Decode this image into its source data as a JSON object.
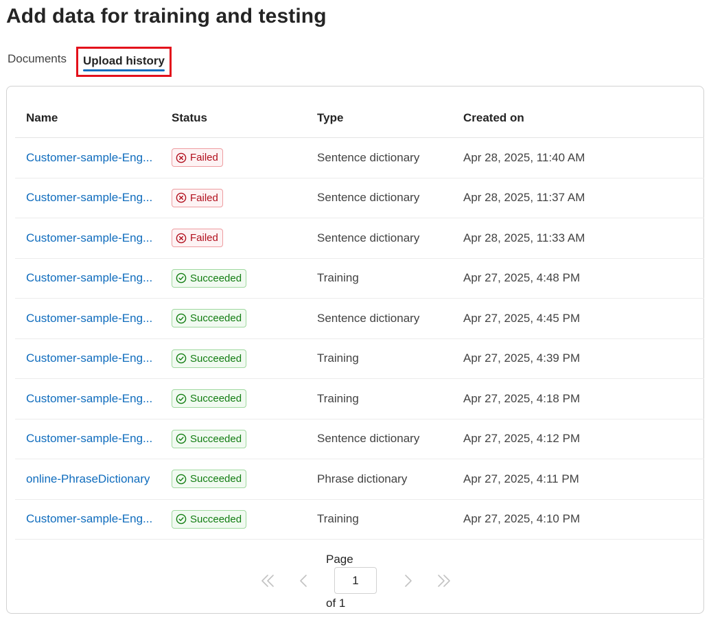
{
  "page": {
    "title": "Add data for training and testing"
  },
  "tabs": [
    {
      "label": "Documents",
      "selected": false
    },
    {
      "label": "Upload history",
      "selected": true
    }
  ],
  "table": {
    "columns": [
      "Name",
      "Status",
      "Type",
      "Created on"
    ],
    "rows": [
      {
        "name": "Customer-sample-Eng...",
        "status": "Failed",
        "type": "Sentence dictionary",
        "created": "Apr 28, 2025, 11:40 AM"
      },
      {
        "name": "Customer-sample-Eng...",
        "status": "Failed",
        "type": "Sentence dictionary",
        "created": "Apr 28, 2025, 11:37 AM"
      },
      {
        "name": "Customer-sample-Eng...",
        "status": "Failed",
        "type": "Sentence dictionary",
        "created": "Apr 28, 2025, 11:33 AM"
      },
      {
        "name": "Customer-sample-Eng...",
        "status": "Succeeded",
        "type": "Training",
        "created": "Apr 27, 2025, 4:48 PM"
      },
      {
        "name": "Customer-sample-Eng...",
        "status": "Succeeded",
        "type": "Sentence dictionary",
        "created": "Apr 27, 2025, 4:45 PM"
      },
      {
        "name": "Customer-sample-Eng...",
        "status": "Succeeded",
        "type": "Training",
        "created": "Apr 27, 2025, 4:39 PM"
      },
      {
        "name": "Customer-sample-Eng...",
        "status": "Succeeded",
        "type": "Training",
        "created": "Apr 27, 2025, 4:18 PM"
      },
      {
        "name": "Customer-sample-Eng...",
        "status": "Succeeded",
        "type": "Sentence dictionary",
        "created": "Apr 27, 2025, 4:12 PM"
      },
      {
        "name": "online-PhraseDictionary",
        "status": "Succeeded",
        "type": "Phrase dictionary",
        "created": "Apr 27, 2025, 4:11 PM"
      },
      {
        "name": "Customer-sample-Eng...",
        "status": "Succeeded",
        "type": "Training",
        "created": "Apr 27, 2025, 4:10 PM"
      }
    ]
  },
  "pagination": {
    "label": "Page",
    "current_page": "1",
    "of_label": "of 1"
  },
  "icons": {
    "failed": "error-circle-icon",
    "succeeded": "checkmark-circle-icon",
    "first": "double-chevron-left-icon",
    "prev": "chevron-left-icon",
    "next": "chevron-right-icon",
    "last": "double-chevron-right-icon"
  },
  "colors": {
    "link": "#0f6cbd",
    "tab_underline": "#0f6cbd",
    "highlight_box": "#e3101b",
    "failed_text": "#b10e1c",
    "failed_border": "#ee9ca0",
    "succeeded_text": "#107c10",
    "succeeded_border": "#9fd89f"
  }
}
